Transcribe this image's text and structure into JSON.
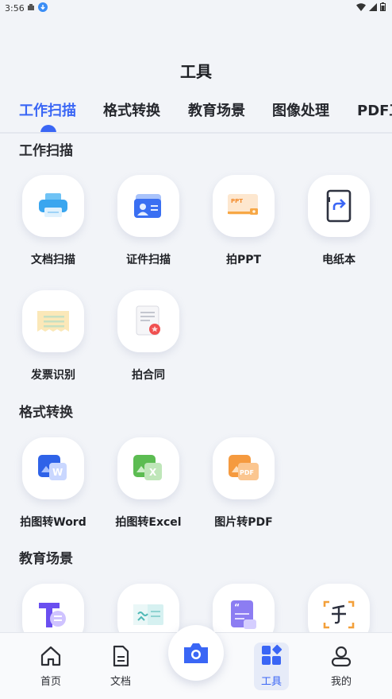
{
  "status_bar": {
    "time": "3:56"
  },
  "header": {
    "title": "工具"
  },
  "tabs": [
    {
      "label": "工作扫描",
      "active": true
    },
    {
      "label": "格式转换"
    },
    {
      "label": "教育场景"
    },
    {
      "label": "图像处理"
    },
    {
      "label": "PDF工具"
    }
  ],
  "sections": {
    "work_scan": {
      "title": "工作扫描",
      "items": [
        {
          "label": "文档扫描",
          "icon": "printer-icon"
        },
        {
          "label": "证件扫描",
          "icon": "id-card-icon"
        },
        {
          "label": "拍PPT",
          "icon": "ppt-icon"
        },
        {
          "label": "电纸本",
          "icon": "e-paper-icon"
        },
        {
          "label": "发票识别",
          "icon": "invoice-icon"
        },
        {
          "label": "拍合同",
          "icon": "contract-icon"
        }
      ]
    },
    "format_convert": {
      "title": "格式转换",
      "items": [
        {
          "label": "拍图转Word",
          "icon": "word-icon"
        },
        {
          "label": "拍图转Excel",
          "icon": "excel-icon"
        },
        {
          "label": "图片转PDF",
          "icon": "pdf-icon"
        }
      ]
    },
    "education": {
      "title": "教育场景",
      "items": [
        {
          "icon": "text-recognition-icon"
        },
        {
          "icon": "wrong-question-icon"
        },
        {
          "icon": "document-quote-icon"
        },
        {
          "icon": "handwriting-icon"
        }
      ]
    }
  },
  "bottom_nav": {
    "items": [
      {
        "label": "首页",
        "icon": "home-icon"
      },
      {
        "label": "文档",
        "icon": "document-icon"
      },
      {
        "label": "工具",
        "icon": "tools-icon",
        "active": true
      },
      {
        "label": "我的",
        "icon": "profile-icon"
      }
    ],
    "camera": {
      "icon": "camera-icon"
    }
  },
  "colors": {
    "accent": "#3a66f5",
    "background": "#f2f4f8"
  }
}
